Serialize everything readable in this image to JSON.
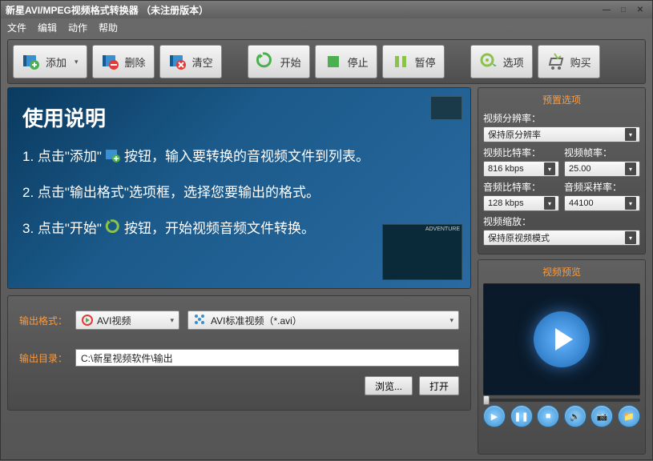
{
  "title": "新星AVI/MPEG视频格式转换器 （未注册版本）",
  "menu": {
    "file": "文件",
    "edit": "编辑",
    "action": "动作",
    "help": "帮助"
  },
  "toolbar": {
    "add": "添加",
    "delete": "删除",
    "clear": "清空",
    "start": "开始",
    "stop": "停止",
    "pause": "暂停",
    "options": "选项",
    "buy": "购买"
  },
  "instructions": {
    "title": "使用说明",
    "line1_a": "1. 点击\"添加\"",
    "line1_b": "按钮，输入要转换的音视频文件到列表。",
    "line2": "2. 点击\"输出格式\"选项框，选择您要输出的格式。",
    "line3_a": "3. 点击\"开始\"",
    "line3_b": "按钮，开始视频音频文件转换。",
    "thumb_label": "ADVENTURE"
  },
  "output": {
    "format_label": "输出格式：",
    "format_category": "AVI视频",
    "format_profile": "AVI标准视频（*.avi）",
    "dir_label": "输出目录：",
    "dir_value": "C:\\新星视频软件\\输出",
    "browse": "浏览...",
    "open": "打开"
  },
  "preset": {
    "title": "预置选项",
    "resolution_label": "视频分辨率：",
    "resolution": "保持原分辨率",
    "vbitrate_label": "视频比特率：",
    "vbitrate": "816 kbps",
    "framerate_label": "视频帧率：",
    "framerate": "25.00",
    "abitrate_label": "音频比特率：",
    "abitrate": "128 kbps",
    "samplerate_label": "音频采样率：",
    "samplerate": "44100",
    "scale_label": "视频缩放：",
    "scale": "保持原视频模式"
  },
  "preview": {
    "title": "视频预览"
  }
}
